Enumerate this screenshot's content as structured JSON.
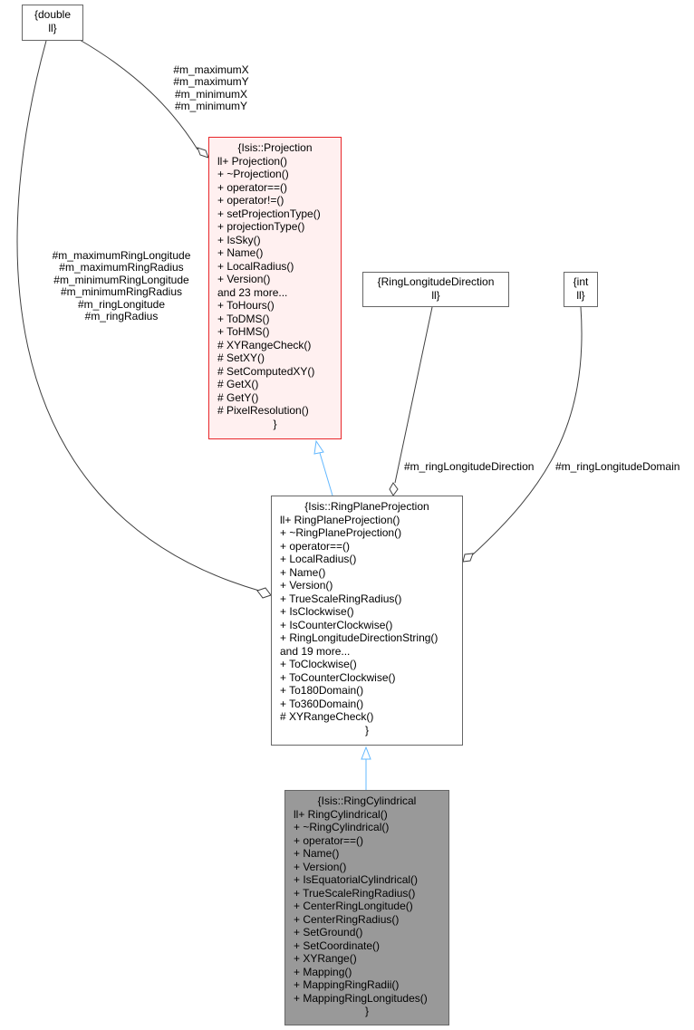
{
  "diagram": {
    "colors": {
      "inheritance_edge": "#63b8ff",
      "association_edge": "#404040",
      "focus_node_fill": "#999999",
      "base_node_fill": "#fff0f0",
      "base_node_border": "#e8262a",
      "node_border": "#666666"
    },
    "nodes": {
      "double": {
        "title": "{double",
        "close": "ll}"
      },
      "ring_longitude_direction": {
        "title": "{RingLongitudeDirection",
        "close": "ll}"
      },
      "int": {
        "title": "{int",
        "close": "ll}"
      },
      "projection": {
        "title": "{Isis::Projection",
        "lines": [
          "ll+ Projection()",
          "+ ~Projection()",
          "+ operator==()",
          "+ operator!=()",
          "+ setProjectionType()",
          "+ projectionType()",
          "+ IsSky()",
          "+ Name()",
          "+ LocalRadius()",
          "+ Version()",
          "and 23 more...",
          "+ ToHours()",
          "+ ToDMS()",
          "+ ToHMS()",
          "# XYRangeCheck()",
          "# SetXY()",
          "# SetComputedXY()",
          "# GetX()",
          "# GetY()",
          "# PixelResolution()"
        ],
        "close": "}"
      },
      "ring_plane_projection": {
        "title": "{Isis::RingPlaneProjection",
        "lines": [
          "ll+ RingPlaneProjection()",
          "+ ~RingPlaneProjection()",
          "+ operator==()",
          "+ LocalRadius()",
          "+ Name()",
          "+ Version()",
          "+ TrueScaleRingRadius()",
          "+ IsClockwise()",
          "+ IsCounterClockwise()",
          "+ RingLongitudeDirectionString()",
          "and 19 more...",
          "+ ToClockwise()",
          "+ ToCounterClockwise()",
          "+ To180Domain()",
          "+ To360Domain()",
          "# XYRangeCheck()"
        ],
        "close": "}"
      },
      "ring_cylindrical": {
        "title": "{Isis::RingCylindrical",
        "lines": [
          "ll+ RingCylindrical()",
          "+ ~RingCylindrical()",
          "+ operator==()",
          "+ Name()",
          "+ Version()",
          "+ IsEquatorialCylindrical()",
          "+ TrueScaleRingRadius()",
          "+ CenterRingLongitude()",
          "+ CenterRingRadius()",
          "+ SetGround()",
          "+ SetCoordinate()",
          "+ XYRange()",
          "+ Mapping()",
          "+ MappingRingRadii()",
          "+ MappingRingLongitudes()"
        ],
        "close": "}"
      }
    },
    "edge_labels": {
      "xy_members": [
        "#m_maximumX",
        "#m_maximumY",
        "#m_minimumX",
        "#m_minimumY"
      ],
      "ring_members": [
        "#m_maximumRingLongitude",
        "#m_maximumRingRadius",
        "#m_minimumRingLongitude",
        "#m_minimumRingRadius",
        "#m_ringLongitude",
        "#m_ringRadius"
      ],
      "direction": "#m_ringLongitudeDirection",
      "domain": "#m_ringLongitudeDomain"
    }
  }
}
